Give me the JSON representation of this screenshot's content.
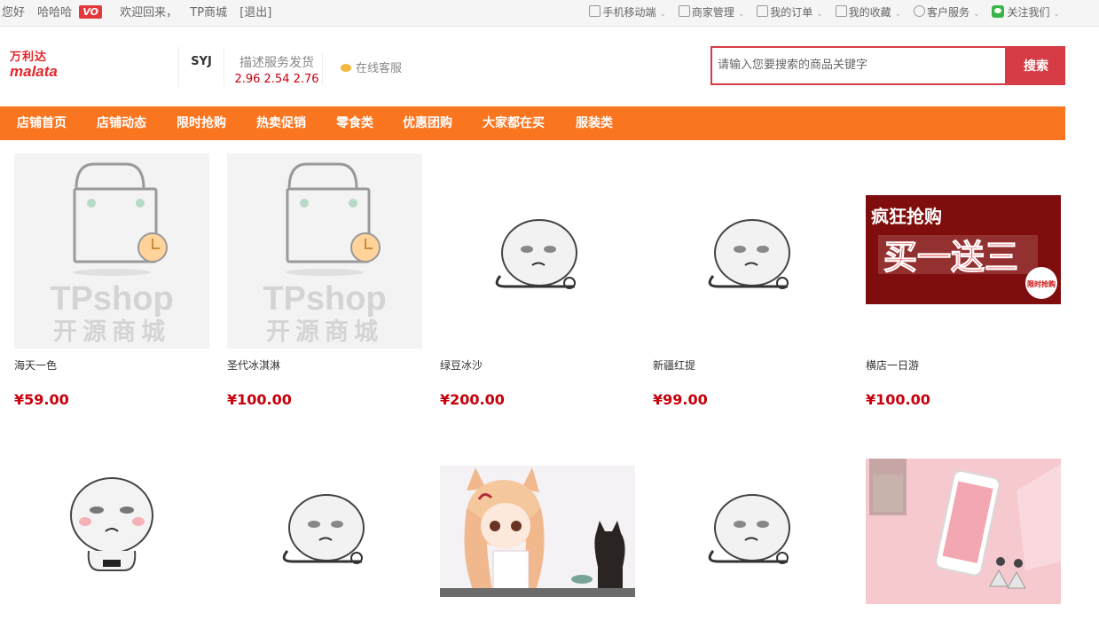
{
  "topbar": {
    "greeting": "您好",
    "username": "哈哈哈",
    "vip": "VO",
    "welcome": "欢迎回来，",
    "site": "TP商城",
    "logout": "[退出]",
    "links": [
      "手机移动端",
      "商家管理",
      "我的订单",
      "我的收藏",
      "客户服务",
      "关注我们"
    ]
  },
  "header": {
    "logo_cn": "万利达",
    "logo_en": "malata",
    "shop_name": "SYJ",
    "score_labels": "描述服务发货",
    "score_values": "2.96 2.54 2.76",
    "online_service": "在线客服"
  },
  "search": {
    "placeholder": "请输入您要搜索的商品关键字",
    "button": "搜索"
  },
  "colors": {
    "nav_bg": "#fa7520",
    "search_accent": "#d63c45",
    "price": "#c7000b"
  },
  "nav": [
    "店铺首页",
    "店铺动态",
    "限时抢购",
    "热卖促销",
    "零食类",
    "优惠团购",
    "大家都在买",
    "服装类"
  ],
  "products": [
    {
      "name": "海天一色",
      "price": "¥59.00",
      "image": "tpshop-placeholder"
    },
    {
      "name": "圣代冰淇淋",
      "price": "¥100.00",
      "image": "tpshop-placeholder"
    },
    {
      "name": "绿豆冰沙",
      "price": "¥200.00",
      "image": "meme-face"
    },
    {
      "name": "新疆红提",
      "price": "¥99.00",
      "image": "meme-face"
    },
    {
      "name": "横店一日游",
      "price": "¥100.00",
      "image": "flash-sale-banner"
    },
    {
      "name": "",
      "price": "",
      "image": "meme-face-blush"
    },
    {
      "name": "",
      "price": "",
      "image": "meme-face"
    },
    {
      "name": "",
      "price": "",
      "image": "anime-girl-cat"
    },
    {
      "name": "",
      "price": "",
      "image": "meme-face"
    },
    {
      "name": "",
      "price": "",
      "image": "pink-phone"
    }
  ],
  "banner": {
    "line1": "疯狂抢购",
    "line2": "买一送三",
    "badge": "限时抢购"
  },
  "placeholder_text": {
    "en": "TPshop",
    "cn": "开源商城"
  }
}
